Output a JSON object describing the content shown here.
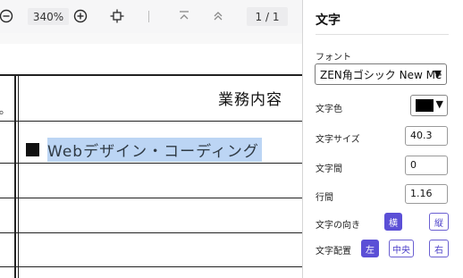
{
  "toolbar": {
    "zoom_value": "340%",
    "page_indicator": "1 / 1"
  },
  "document": {
    "cut_text": "。",
    "header_cell": "業務内容",
    "cell_text": "Webデザイン・コーディング"
  },
  "panel": {
    "title": "文字",
    "font_label": "フォント",
    "font_value": "ZEN角ゴシック New Me",
    "color_label": "文字色",
    "color_value": "#000000",
    "size_label": "文字サイズ",
    "size_value": "40.3",
    "spacing_label": "文字間",
    "spacing_value": "0",
    "line_label": "行間",
    "line_value": "1.16",
    "direction_label": "文字の向き",
    "direction_horizontal": "横",
    "direction_vertical": "縦",
    "align_label": "文字配置",
    "align_left": "左",
    "align_center": "中央",
    "align_right": "右"
  },
  "colors": {
    "accent": "#5b4fd6",
    "highlight": "#bcd5f4"
  }
}
